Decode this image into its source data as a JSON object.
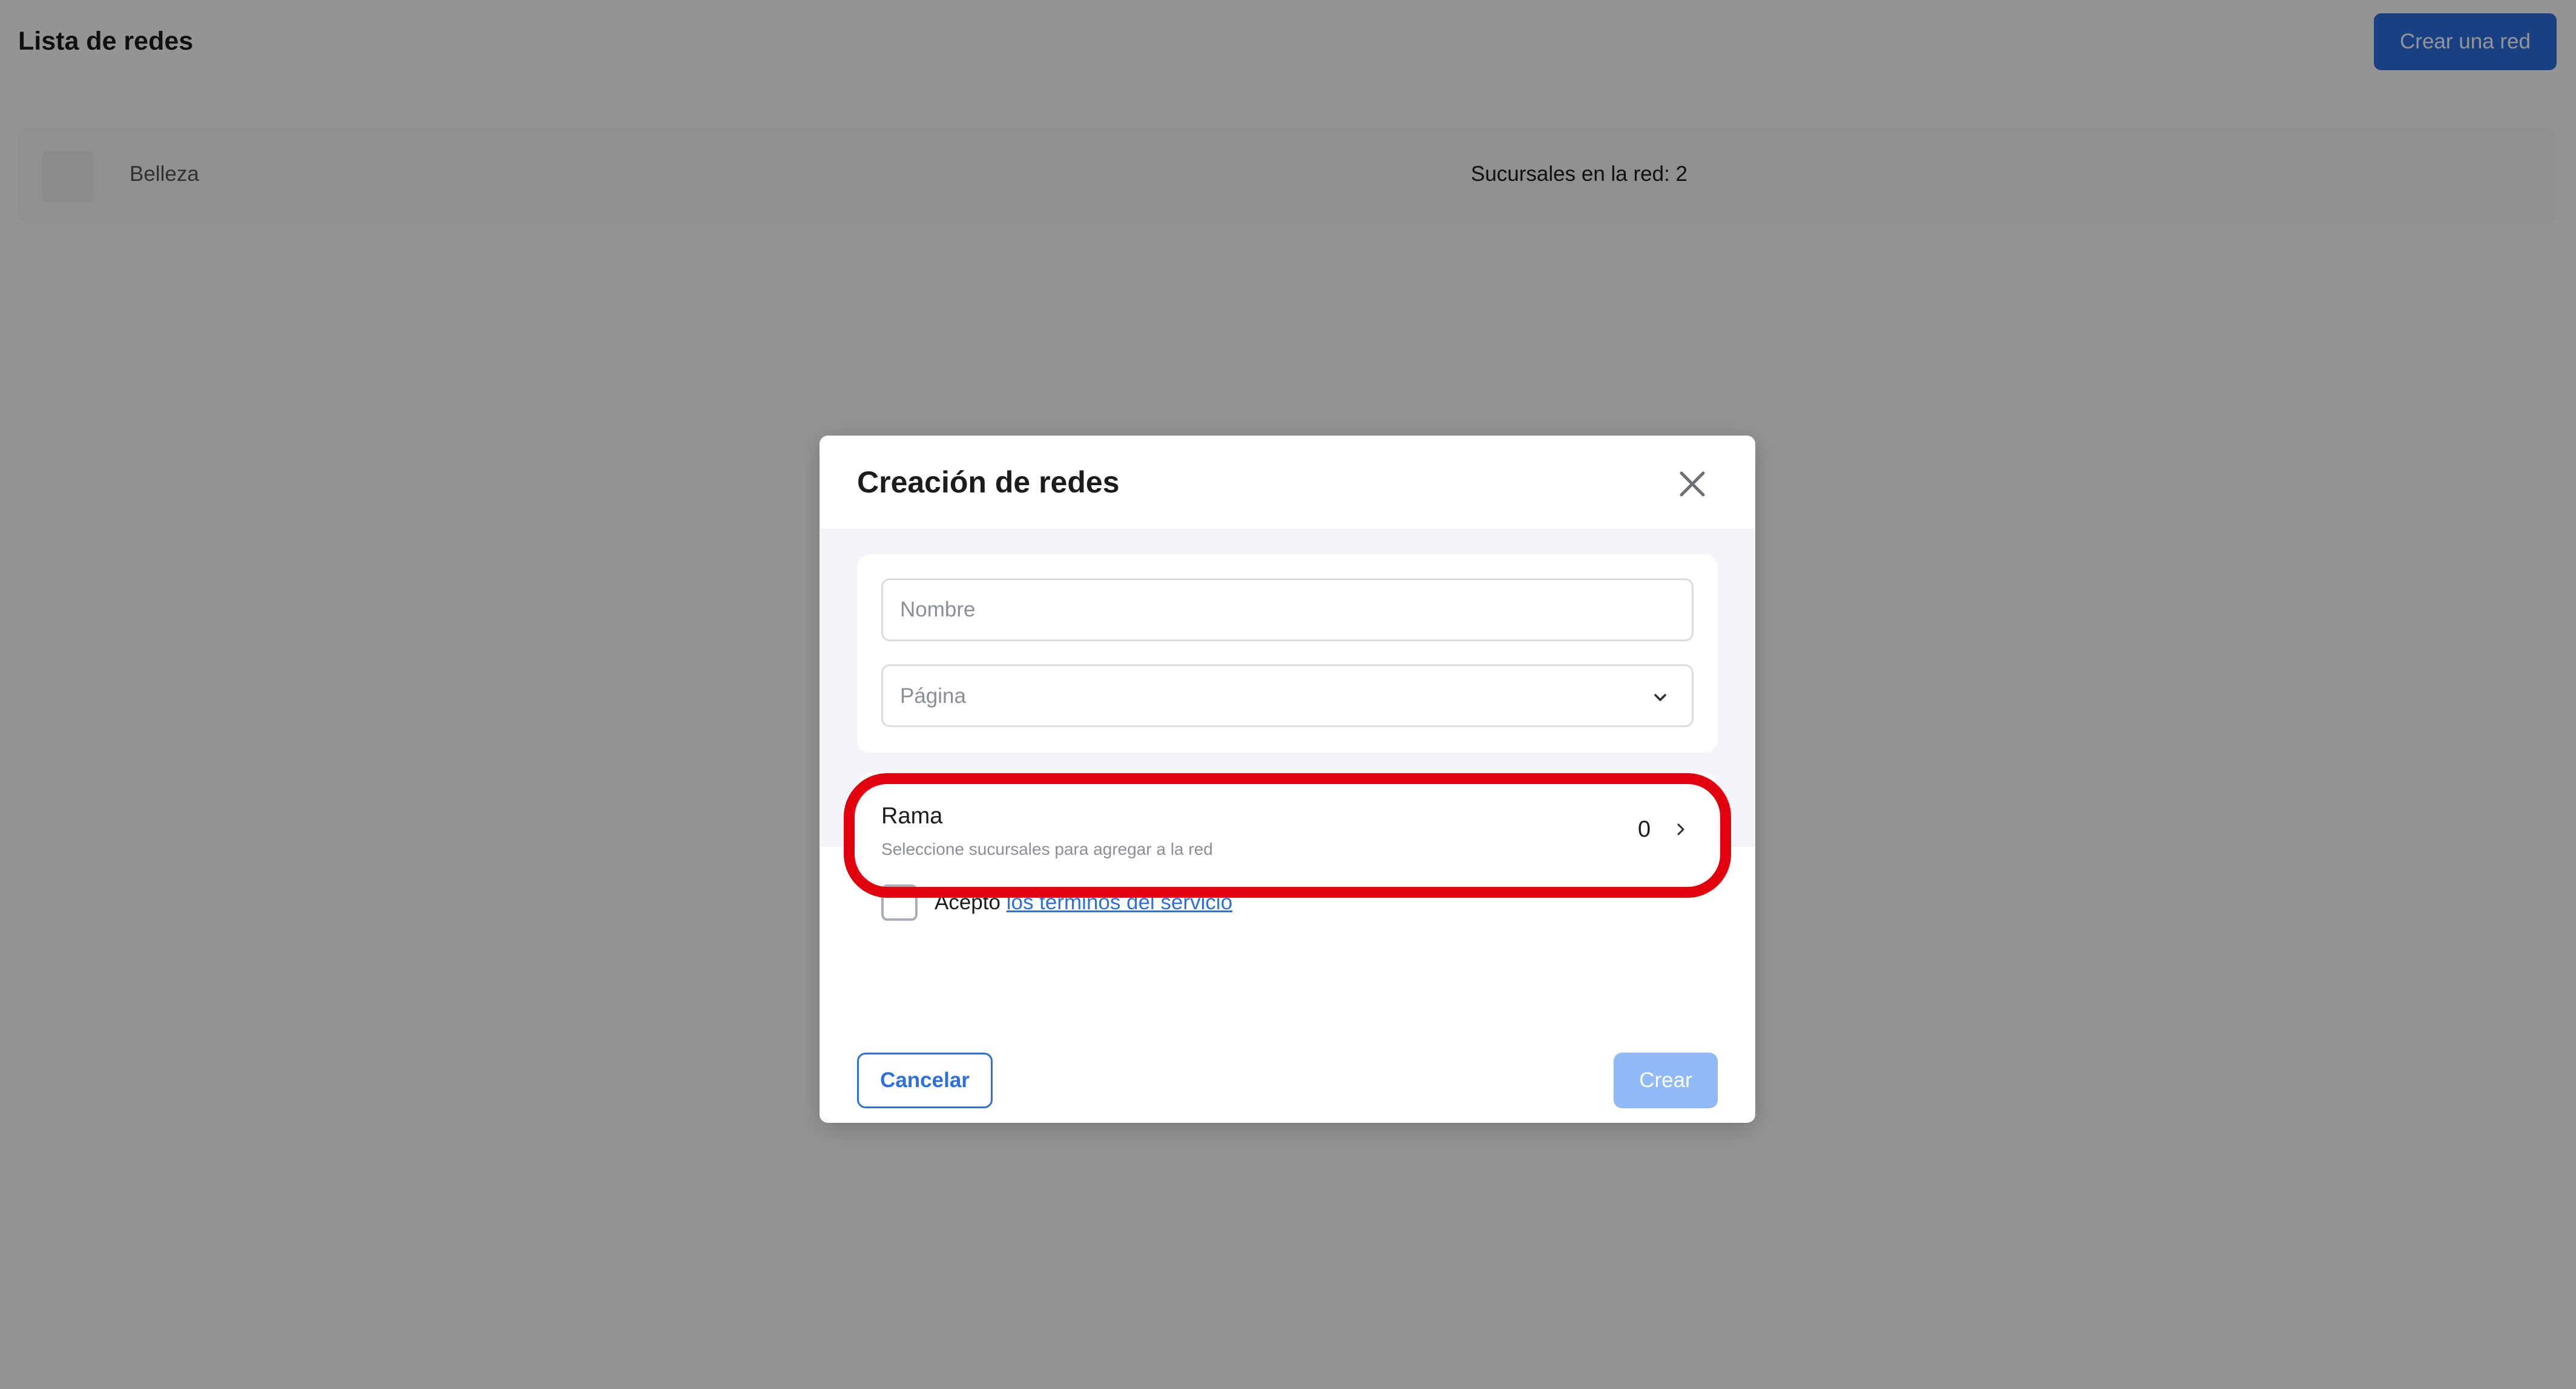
{
  "page": {
    "title": "Lista de redes",
    "create_button": "Crear una red",
    "networks": [
      {
        "name": "Belleza",
        "branches_text": "Sucursales en la red: 2"
      }
    ]
  },
  "modal": {
    "title": "Creación de redes",
    "name_field": {
      "placeholder": "Nombre",
      "value": ""
    },
    "page_select": {
      "placeholder": "Página"
    },
    "branch": {
      "title": "Rama",
      "subtitle": "Seleccione sucursales para agregar a la red",
      "count": "0"
    },
    "terms": {
      "prefix": "Acepto",
      "link": "los términos del servicio",
      "checked": false
    },
    "cancel_label": "Cancelar",
    "submit_label": "Crear"
  },
  "colors": {
    "accent": "#2b6fe0",
    "accent_disabled": "#8fbaf7",
    "highlight": "#e3000e"
  },
  "icons": [
    "close-icon",
    "chevron-down-icon",
    "chevron-right-icon"
  ]
}
